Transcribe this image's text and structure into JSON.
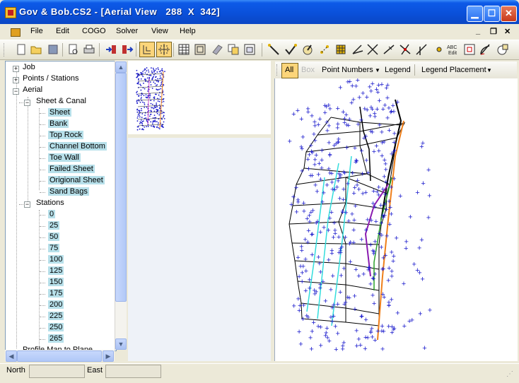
{
  "window": {
    "title": "Gov & Bob.CS2 - [Aerial View   288  X  342]"
  },
  "menu": [
    "File",
    "Edit",
    "COGO",
    "Solver",
    "View",
    "Help"
  ],
  "mdi_controls": [
    "_",
    "❐",
    "✕"
  ],
  "toolbar_icons": [
    "new-file-icon",
    "open-folder-icon",
    "save-icon",
    "print-preview-icon",
    "print-icon",
    "import-icon",
    "export-icon",
    "select-icon",
    "select-all-icon",
    "grid-icon",
    "layer-icon",
    "erase-icon",
    "copy-icon",
    "window-icon",
    "line-icon",
    "check-icon",
    "compass-icon",
    "point-icon",
    "block-icon",
    "angle-icon",
    "cross-icon",
    "slope-icon",
    "intersect-icon",
    "perpendicular-icon",
    "point-insert-icon",
    "abc-edit-icon",
    "zoom-window-icon",
    "arc-icon",
    "shape-icon"
  ],
  "toolbar_abc": "ABC",
  "toolbar_abc_sub": "Edit",
  "tree": {
    "job": "Job",
    "points": "Points / Stations",
    "aerial": "Aerial",
    "sheet_canal": "Sheet & Canal",
    "layers": [
      "Sheet",
      "Bank",
      "Top Rock",
      "Channel Bottom",
      "Toe Wall",
      "Failed Sheet",
      "Origional Sheet",
      "Sand Bags"
    ],
    "stations_label": "Stations",
    "stations": [
      "0",
      "25",
      "50",
      "75",
      "100",
      "125",
      "150",
      "175",
      "200",
      "225",
      "250",
      "265"
    ],
    "cut_off": "Profile Man to Plane"
  },
  "view_toolbar": {
    "all": "All",
    "box": "Box",
    "point_numbers": "Point Numbers",
    "legend": "Legend",
    "legend_placement": "Legend Placement"
  },
  "status": {
    "north_label": "North",
    "east_label": "East"
  },
  "colors": {
    "title_bar": "#0a4fd8",
    "points": "#1a1acc",
    "highlight": "#b7e0ea",
    "line_orange": "#ef7f1a",
    "line_cyan": "#33dddd",
    "line_purple": "#8a1ab0",
    "line_green": "#2aa02a"
  }
}
